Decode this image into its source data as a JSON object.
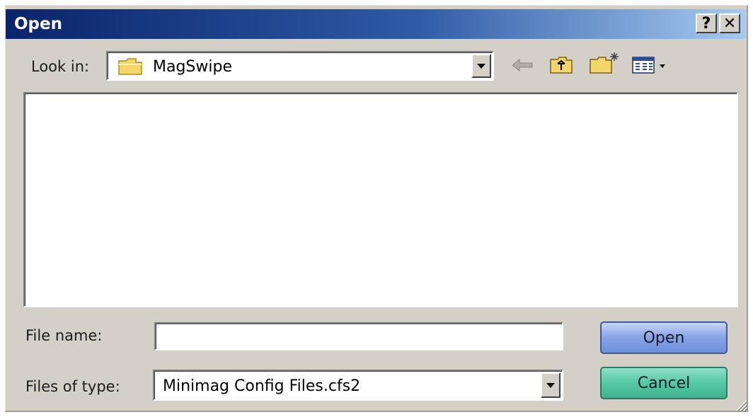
{
  "window": {
    "title": "Open",
    "help_label": "?",
    "close_label": "✕"
  },
  "look_in": {
    "label": "Look in:",
    "value": "MagSwipe",
    "toolbar_icons": [
      "back-arrow-icon",
      "up-one-level-icon",
      "create-new-folder-icon",
      "view-menu-icon"
    ]
  },
  "file_list": {
    "items": []
  },
  "file_name": {
    "label": "File name:",
    "value": ""
  },
  "file_type": {
    "label": "Files of type:",
    "value": "Minimag Config Files.cfs2"
  },
  "buttons": {
    "open_label": "Open",
    "cancel_label": "Cancel"
  },
  "colors": {
    "title_gradient_start": "#0a246a",
    "title_gradient_end": "#a6caf0",
    "dialog_face": "#d4d0c8",
    "open_button": "#8aa6e6",
    "cancel_button": "#55c8a4",
    "folder_yellow": "#f5d66a"
  }
}
